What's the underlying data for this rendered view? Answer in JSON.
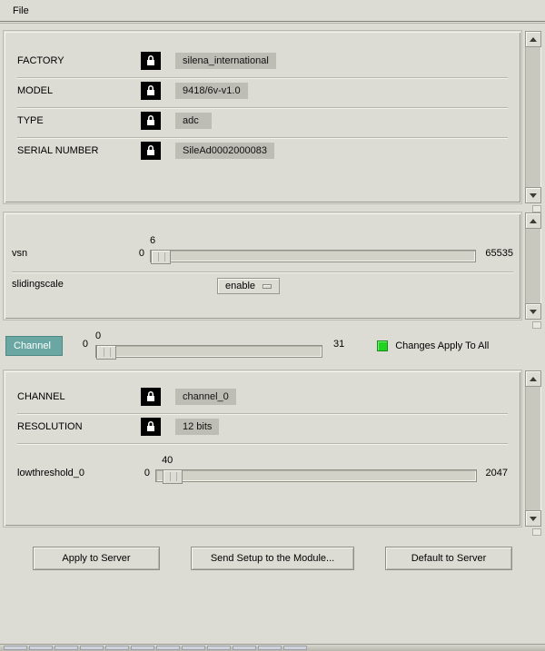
{
  "menu": {
    "file": "File"
  },
  "device": {
    "fields": [
      {
        "label": "FACTORY",
        "value": "silena_international"
      },
      {
        "label": "MODEL",
        "value": "9418/6v-v1.0"
      },
      {
        "label": "TYPE",
        "value": "adc"
      },
      {
        "label": "SERIAL NUMBER",
        "value": "SileAd0002000083"
      }
    ]
  },
  "params": {
    "vsn": {
      "label": "vsn",
      "min": 0,
      "max": 65535,
      "value": 6
    },
    "slidingscale": {
      "label": "slidingscale",
      "selected": "enable"
    }
  },
  "channel_select": {
    "button": "Channel",
    "min": 0,
    "max": 31,
    "value": 0,
    "apply_all": "Changes Apply To All"
  },
  "channel": {
    "name": {
      "label": "CHANNEL",
      "value": "channel_0"
    },
    "resolution": {
      "label": "RESOLUTION",
      "value": "12 bits"
    },
    "lowthreshold": {
      "label": "lowthreshold_0",
      "min": 0,
      "max": 2047,
      "value": 40
    }
  },
  "buttons": {
    "apply": "Apply to Server",
    "send": "Send Setup to the Module...",
    "default": "Default to Server"
  }
}
